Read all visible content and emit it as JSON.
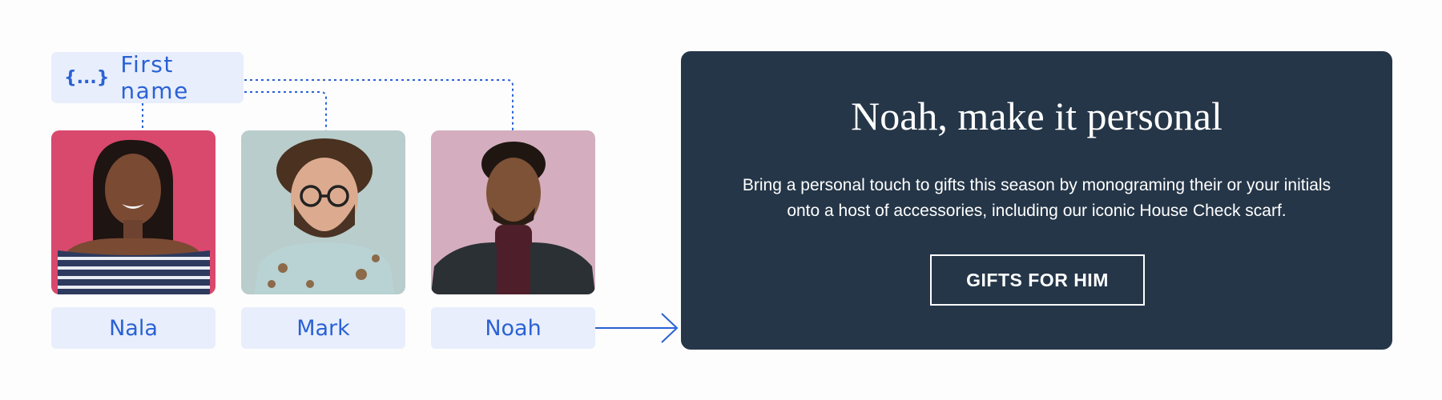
{
  "token": {
    "icon": "{...}",
    "label": "First name"
  },
  "people": [
    {
      "name": "Nala",
      "photo_bg": "#d9486d"
    },
    {
      "name": "Mark",
      "photo_bg": "#b8cdcc"
    },
    {
      "name": "Noah",
      "photo_bg": "#d4aebe"
    }
  ],
  "preview": {
    "title": "Noah, make it personal",
    "body": "Bring a personal touch to gifts this season by monograming their or your initials onto a host of accessories, including our iconic House Check scarf.",
    "cta_label": "GIFTS FOR HIM"
  },
  "colors": {
    "accent": "#2a62d4",
    "chip_bg": "#e8eefc",
    "panel_bg": "#253648"
  }
}
